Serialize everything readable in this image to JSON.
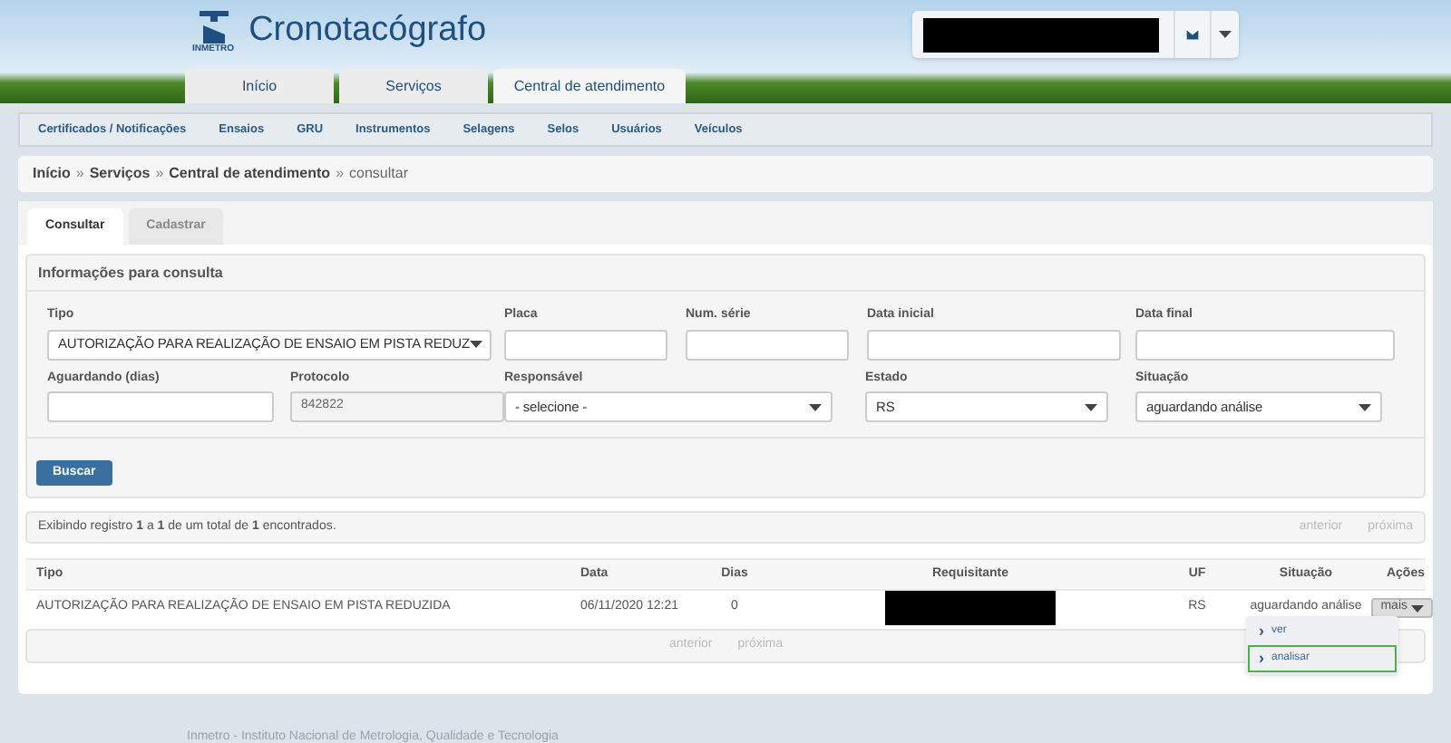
{
  "header": {
    "logo_caption": "INMETRO",
    "app_title": "Cronotacógrafo",
    "main_tabs": [
      {
        "label": "Início",
        "selected": false
      },
      {
        "label": "Serviços",
        "selected": false
      },
      {
        "label": "Central de atendimento",
        "selected": true
      }
    ]
  },
  "nav": [
    "Certificados / Notificações",
    "Ensaios",
    "GRU",
    "Instrumentos",
    "Selagens",
    "Selos",
    "Usuários",
    "Veículos"
  ],
  "breadcrumb": {
    "links": [
      "Início",
      "Serviços",
      "Central de atendimento"
    ],
    "separator": "»",
    "current": "consultar"
  },
  "tabs": [
    {
      "label": "Consultar",
      "selected": true
    },
    {
      "label": "Cadastrar",
      "selected": false
    }
  ],
  "form": {
    "title": "Informações para consulta",
    "fields": [
      {
        "label": "Tipo",
        "kind": "select",
        "value": "AUTORIZAÇÃO PARA REALIZAÇÃO DE ENSAIO EM PISTA REDUZ"
      },
      {
        "label": "Placa",
        "kind": "text"
      },
      {
        "label": "Num. série",
        "kind": "text"
      },
      {
        "label": "Data inicial",
        "kind": "text"
      },
      {
        "label": "Data final",
        "kind": "text"
      },
      {
        "label": "Aguardando (dias)",
        "kind": "text"
      },
      {
        "label": "Protocolo",
        "kind": "readonly",
        "value": "842822"
      },
      {
        "label": "Responsável",
        "kind": "select",
        "value": "- selecione -"
      },
      {
        "label": "Estado",
        "kind": "select",
        "value": "RS"
      },
      {
        "label": "Situação",
        "kind": "select",
        "value": "aguardando análise"
      }
    ],
    "button": "Buscar"
  },
  "summary": {
    "text": "Exibindo registro **1** a **1** de um total de **1** encontrados."
  },
  "pager_top": [
    {
      "label": "anterior",
      "disabled": true
    },
    {
      "label": "próxima",
      "disabled": true
    }
  ],
  "table": {
    "columns": [
      "Tipo",
      "Data",
      "Dias",
      "Requisitante",
      "UF",
      "Situação",
      "Ações"
    ],
    "rows": [
      {
        "tipo": "AUTORIZAÇÃO PARA REALIZAÇÃO DE ENSAIO EM PISTA REDUZIDA",
        "data": "06/11/2020 12:21",
        "dias": "0",
        "uf": "RS",
        "situacao": "aguardando análise",
        "action": "mais",
        "menu": [
          {
            "icon": "›",
            "label": "ver",
            "selected": false
          },
          {
            "icon": "›",
            "label": "analisar",
            "selected": true
          }
        ]
      }
    ]
  },
  "pager_bottom": [
    {
      "label": "anterior",
      "disabled": true
    },
    {
      "label": "próxima",
      "disabled": true
    }
  ],
  "footer": "Inmetro - Instituto Nacional de Metrologia, Qualidade e Tecnologia"
}
